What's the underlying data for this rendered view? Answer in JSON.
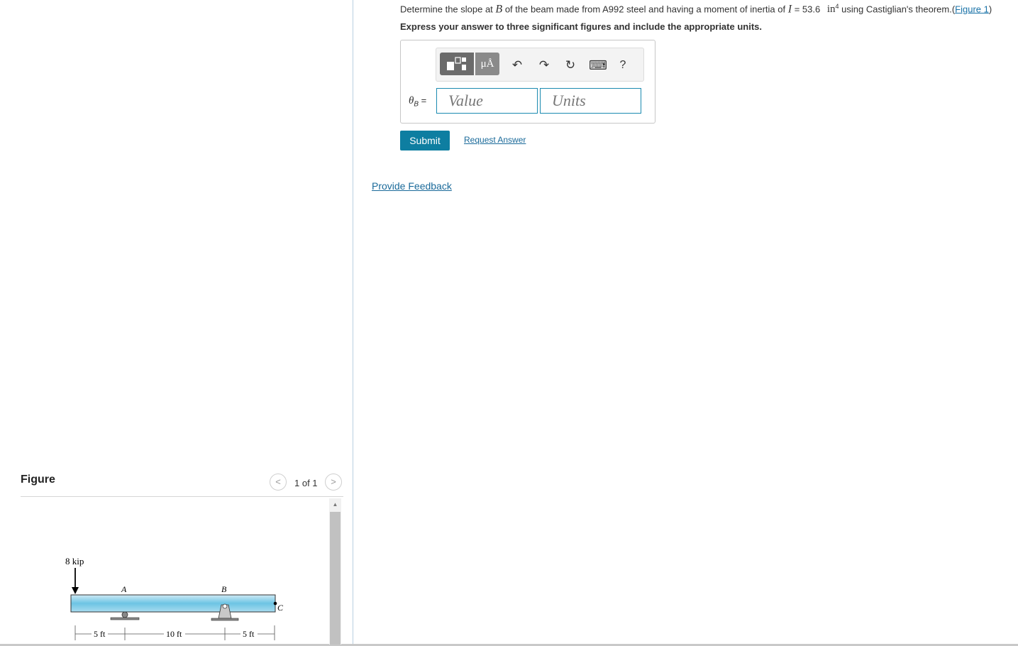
{
  "question": {
    "prefix": "Determine the slope at",
    "point_var": "B",
    "middle": "of the beam made from A992 steel and having a moment of inertia of",
    "inertia_var": "I",
    "inertia_value": "= 53.6",
    "inertia_unit": "in",
    "inertia_exp": "4",
    "suffix": "using Castiglian's theorem.",
    "figure_link_open": "(",
    "figure_link": "Figure 1",
    "figure_link_close": ")"
  },
  "instruction": "Express your answer to three significant figures and include the appropriate units.",
  "answer": {
    "label_symbol": "θ",
    "label_sub": "B",
    "label_eq": "=",
    "value_placeholder": "Value",
    "units_placeholder": "Units"
  },
  "toolbar": {
    "units_label": "μÅ",
    "undo_icon": "↶",
    "redo_icon": "↷",
    "reset_icon": "↻",
    "keyboard_icon": "⌨",
    "help_label": "?"
  },
  "buttons": {
    "submit": "Submit",
    "request_answer": "Request Answer",
    "provide_feedback": "Provide Feedback"
  },
  "figure": {
    "heading": "Figure",
    "page_indicator": "1 of 1",
    "prev_icon": "<",
    "next_icon": ">",
    "load_label": "8 kip",
    "point_a": "A",
    "point_b": "B",
    "point_c": "C",
    "dim_1": "5 ft",
    "dim_2": "10 ft",
    "dim_3": "5 ft"
  }
}
